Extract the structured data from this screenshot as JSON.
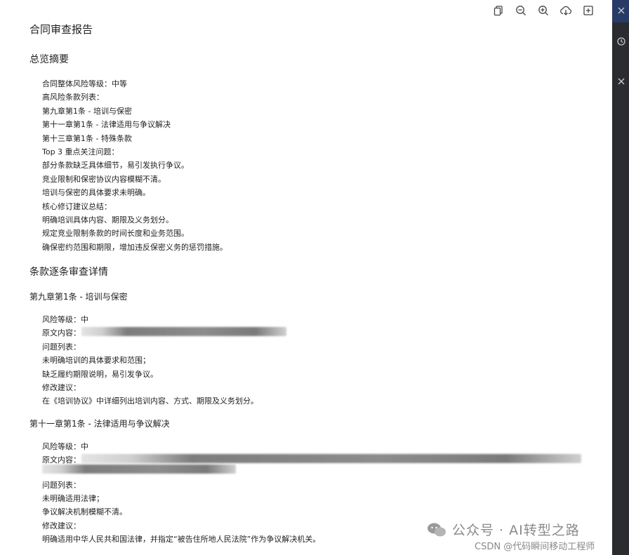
{
  "report": {
    "title": "合同审查报告",
    "summary": {
      "heading": "总览摘要",
      "lines": [
        "合同整体风险等级：中等",
        "高风险条款列表：",
        "第九章第1条 - 培训与保密",
        "第十一章第1条 - 法律适用与争议解决",
        "第十三章第1条 - 特殊条款",
        "Top 3 重点关注问题：",
        "部分条款缺乏具体细节，易引发执行争议。",
        "竞业限制和保密协议内容模糊不清。",
        "培训与保密的具体要求未明确。",
        "核心修订建议总结：",
        "明确培训具体内容、期限及义务划分。",
        "规定竞业限制条款的时间长度和业务范围。",
        "确保密约范围和期限，增加违反保密义务的惩罚措施。"
      ]
    },
    "details": {
      "heading": "条款逐条审查详情",
      "clause1": {
        "heading": "第九章第1条 - 培训与保密",
        "risk": "风险等级：中",
        "original_label": "原文内容：",
        "issues_label": "问题列表：",
        "issues": [
          "未明确培训的具体要求和范围；",
          "缺乏履约期限说明，易引发争议。"
        ],
        "suggest_label": "修改建议：",
        "suggestion": "在《培训协议》中详细列出培训内容、方式、期限及义务划分。"
      },
      "clause2": {
        "heading": "第十一章第1条 - 法律适用与争议解决",
        "risk": "风险等级：中",
        "original_label": "原文内容：",
        "issues_label": "问题列表：",
        "issues": [
          "未明确适用法律；",
          "争议解决机制模糊不清。"
        ],
        "suggest_label": "修改建议：",
        "suggestion": "明确适用中华人民共和国法律，并指定“被告住所地人民法院”作为争议解决机关。"
      }
    }
  },
  "toolbar": {
    "icons": [
      "copy-icon",
      "zoom-out-icon",
      "zoom-in-icon",
      "download-icon",
      "add-icon"
    ]
  },
  "sidebar": {
    "icons": [
      "close-icon",
      "history-icon",
      "close-icon"
    ]
  },
  "watermark": {
    "text": "公众号 · AI转型之路",
    "csdn": "CSDN @代码瞬间移动工程师"
  },
  "colors": {
    "panel": "#2b2c30",
    "panel_top": "#283a66",
    "text": "#1f1f1f"
  }
}
